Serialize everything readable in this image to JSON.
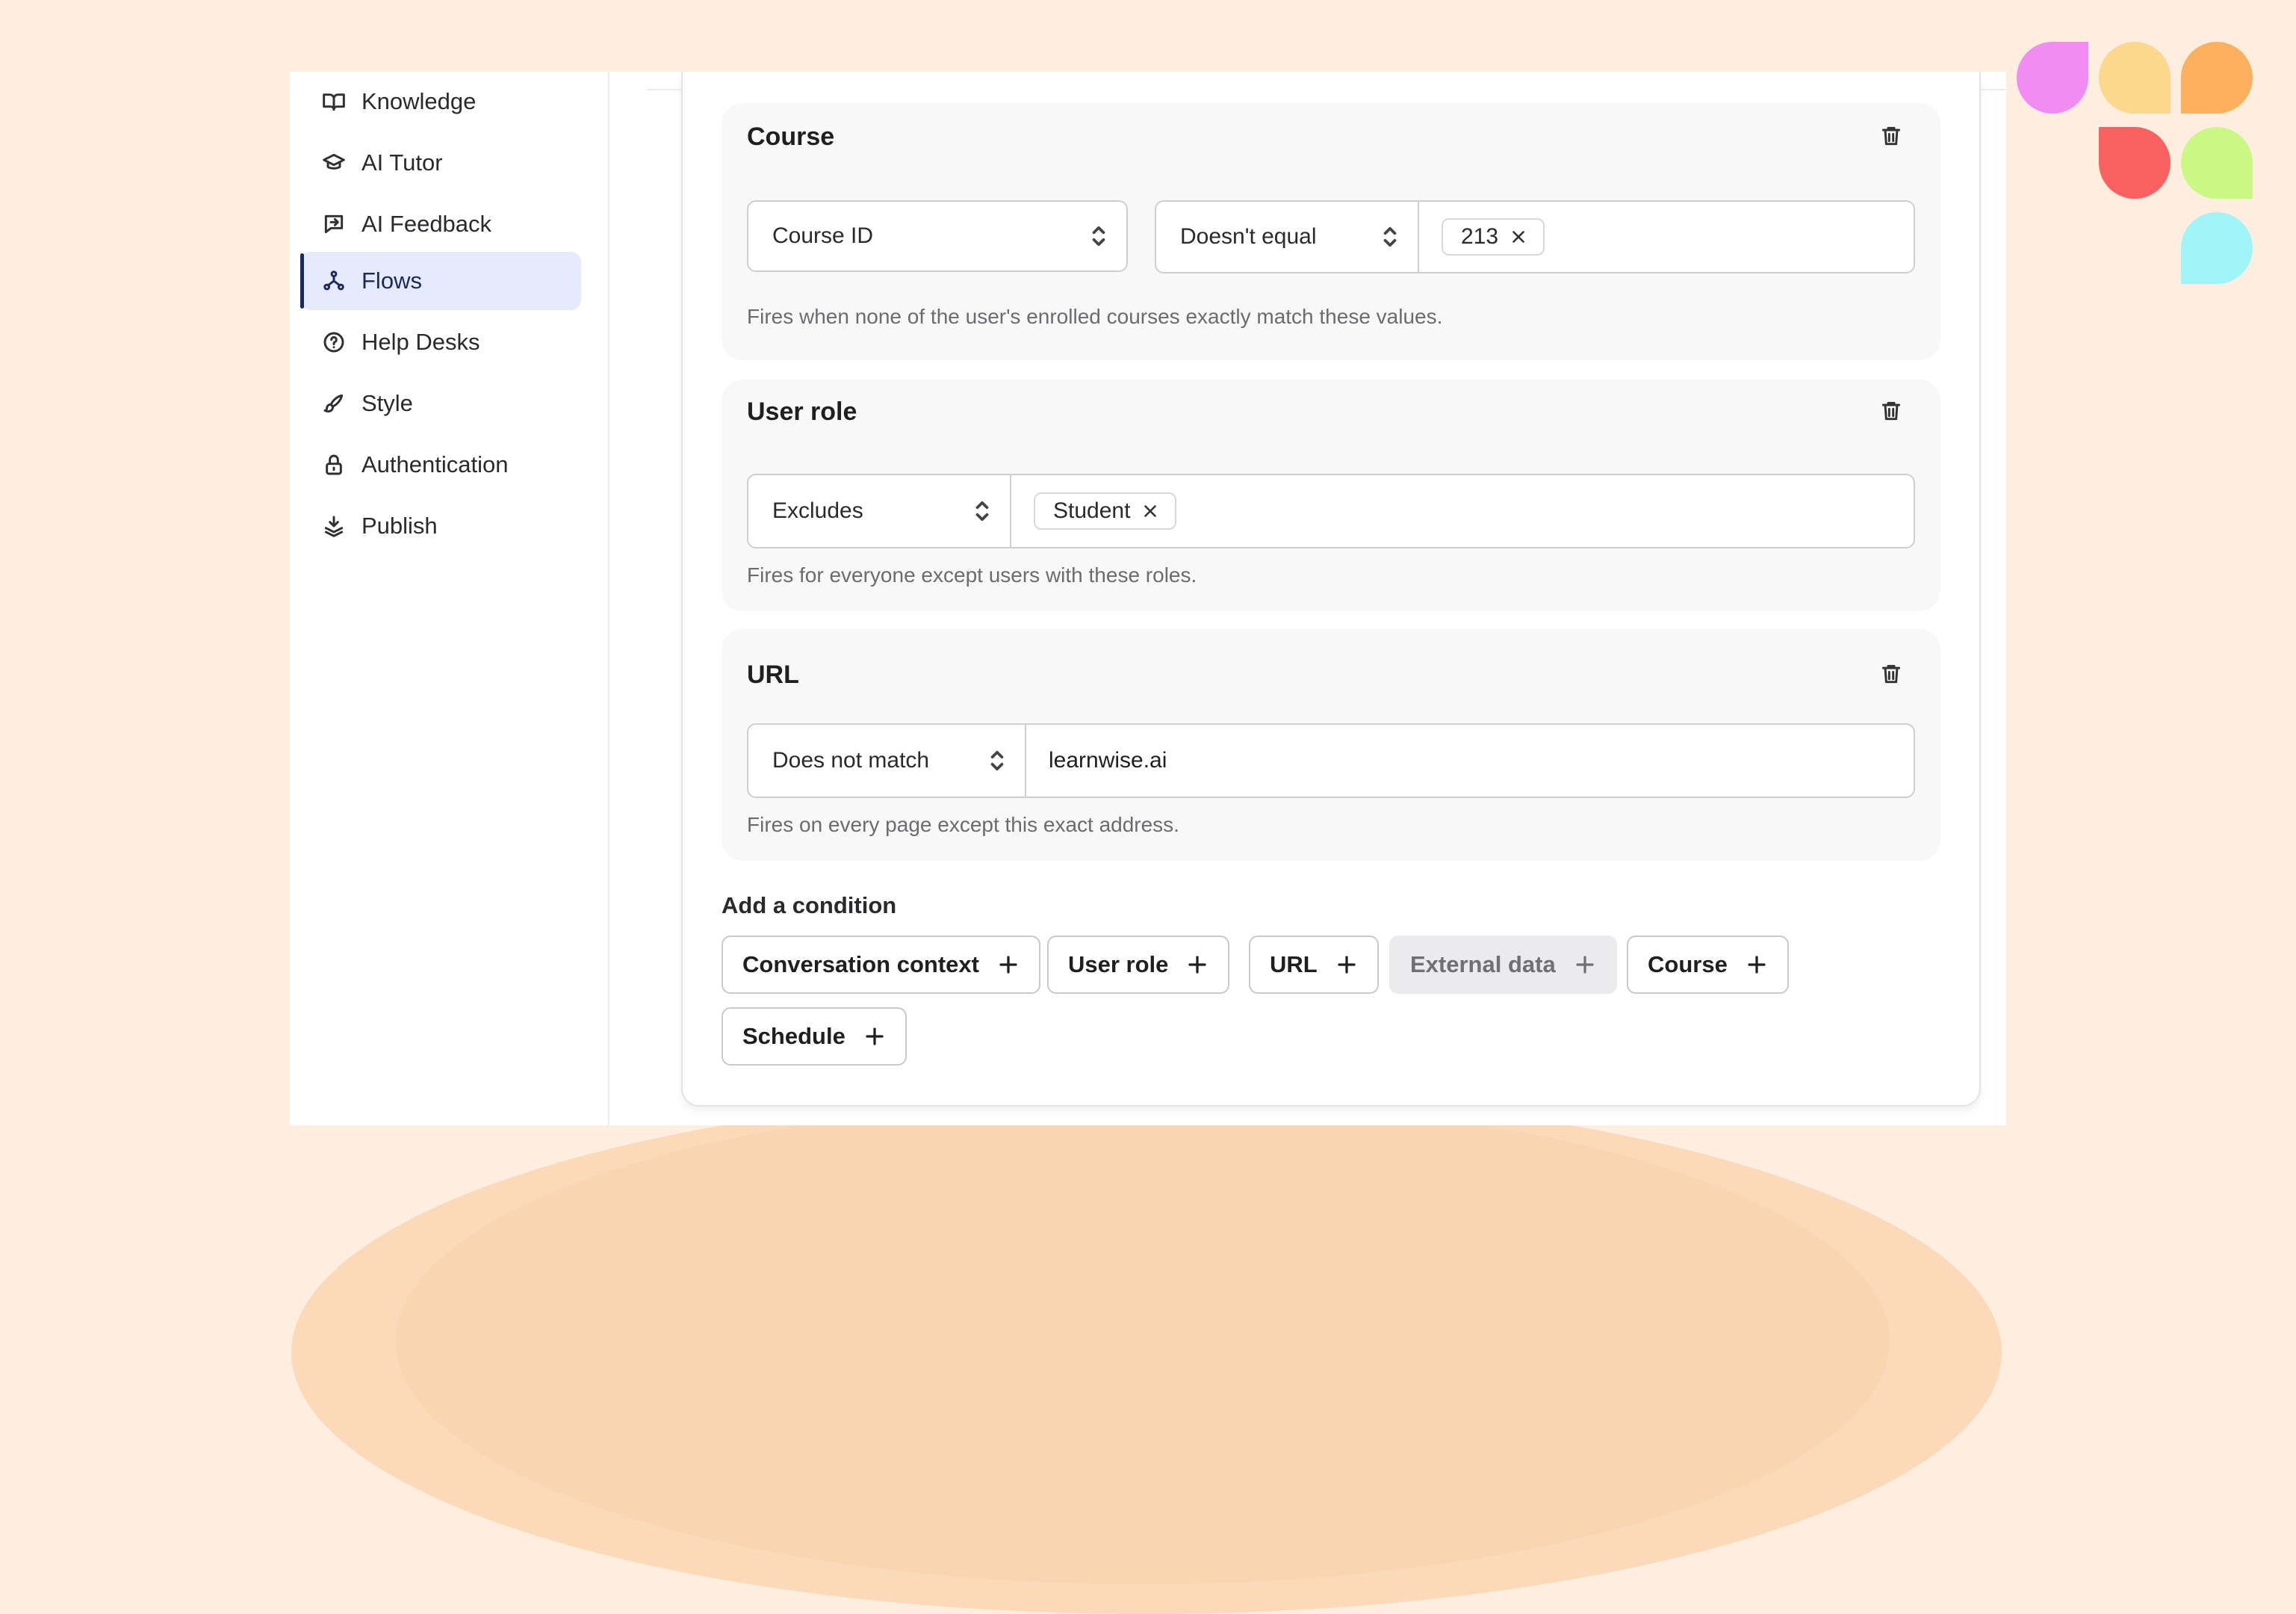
{
  "sidebar": {
    "items": [
      {
        "label": "Knowledge",
        "icon": "book-icon",
        "active": false
      },
      {
        "label": "AI Tutor",
        "icon": "graduation-cap-icon",
        "active": false
      },
      {
        "label": "AI Feedback",
        "icon": "feedback-message-icon",
        "active": false
      },
      {
        "label": "Flows",
        "icon": "flows-icon",
        "active": true
      },
      {
        "label": "Help Desks",
        "icon": "help-circle-icon",
        "active": false
      },
      {
        "label": "Style",
        "icon": "brush-icon",
        "active": false
      },
      {
        "label": "Authentication",
        "icon": "lock-icon",
        "active": false
      },
      {
        "label": "Publish",
        "icon": "publish-icon",
        "active": false
      }
    ]
  },
  "conditions": {
    "course": {
      "title": "Course",
      "field": "Course ID",
      "operator": "Doesn't equal",
      "chip": "213",
      "hint": "Fires when none of the user's enrolled courses exactly match these values."
    },
    "user_role": {
      "title": "User role",
      "operator": "Excludes",
      "chip": "Student",
      "hint": "Fires for everyone except users with these roles."
    },
    "url": {
      "title": "URL",
      "operator": "Does not match",
      "value": "learnwise.ai",
      "hint": "Fires on every page except this exact address."
    }
  },
  "add_condition": {
    "title": "Add a condition",
    "buttons": [
      {
        "label": "Conversation context",
        "disabled": false
      },
      {
        "label": "User role",
        "disabled": false
      },
      {
        "label": "URL",
        "disabled": false
      },
      {
        "label": "External data",
        "disabled": true
      },
      {
        "label": "Course",
        "disabled": false
      },
      {
        "label": "Schedule",
        "disabled": false
      }
    ]
  },
  "colors": {
    "background": "#fdeee0",
    "active_nav": "#e5eafc",
    "accent": "#1b2a5c",
    "logo": [
      "#f28bf2",
      "#fcd78c",
      "#fdb15e",
      "#fc6161",
      "#cbf783",
      "#9ff4f7"
    ]
  }
}
